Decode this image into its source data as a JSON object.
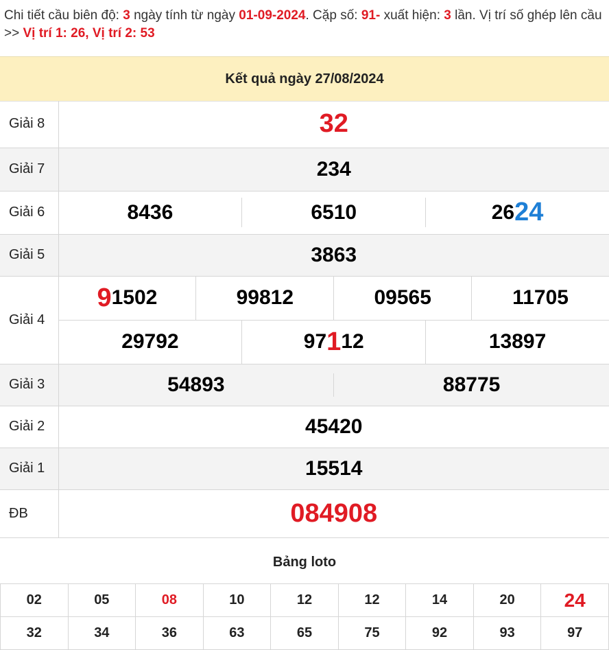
{
  "intro": {
    "p1": "Chi tiết cầu biên độ: ",
    "days": "3",
    "p2": " ngày tính từ ngày ",
    "date": "01-09-2024",
    "p3": ". Cặp số: ",
    "pair": "91-",
    "p4": " xuất hiện: ",
    "times": "3",
    "p5": " lần. Vị trí số ghép lên cầu >> ",
    "positions": "Vị trí 1: 26, Vị trí 2: 53"
  },
  "header": {
    "title": "Kết quả ngày 27/08/2024"
  },
  "prizes": {
    "g8": {
      "label": "Giải 8",
      "value": "32"
    },
    "g7": {
      "label": "Giải 7",
      "value": "234"
    },
    "g6": {
      "label": "Giải 6",
      "v1": "8436",
      "v2": "6510",
      "v3_plain": "26",
      "v3_hl": "24"
    },
    "g5": {
      "label": "Giải 5",
      "value": "3863"
    },
    "g4": {
      "label": "Giải 4",
      "r1c1_hl": "9",
      "r1c1_plain": "1502",
      "r1c2": "99812",
      "r1c3": "09565",
      "r1c4": "11705",
      "r2c1": "29792",
      "r2c2_a": "97",
      "r2c2_hl": "1",
      "r2c2_b": "12",
      "r2c3": "13897"
    },
    "g3": {
      "label": "Giải 3",
      "v1": "54893",
      "v2": "88775"
    },
    "g2": {
      "label": "Giải 2",
      "value": "45420"
    },
    "g1": {
      "label": "Giải 1",
      "value": "15514"
    },
    "db": {
      "label": "ĐB",
      "value": "084908"
    }
  },
  "loto": {
    "title": "Bảng loto",
    "row1": [
      "02",
      "05",
      "08",
      "10",
      "12",
      "12",
      "14",
      "20",
      "24"
    ],
    "row2": [
      "32",
      "34",
      "36",
      "63",
      "65",
      "75",
      "92",
      "93",
      "97"
    ]
  },
  "colors": {
    "accent_red": "#e01b24",
    "accent_blue": "#1e7fd6",
    "header_bg": "#fdf0c0"
  }
}
